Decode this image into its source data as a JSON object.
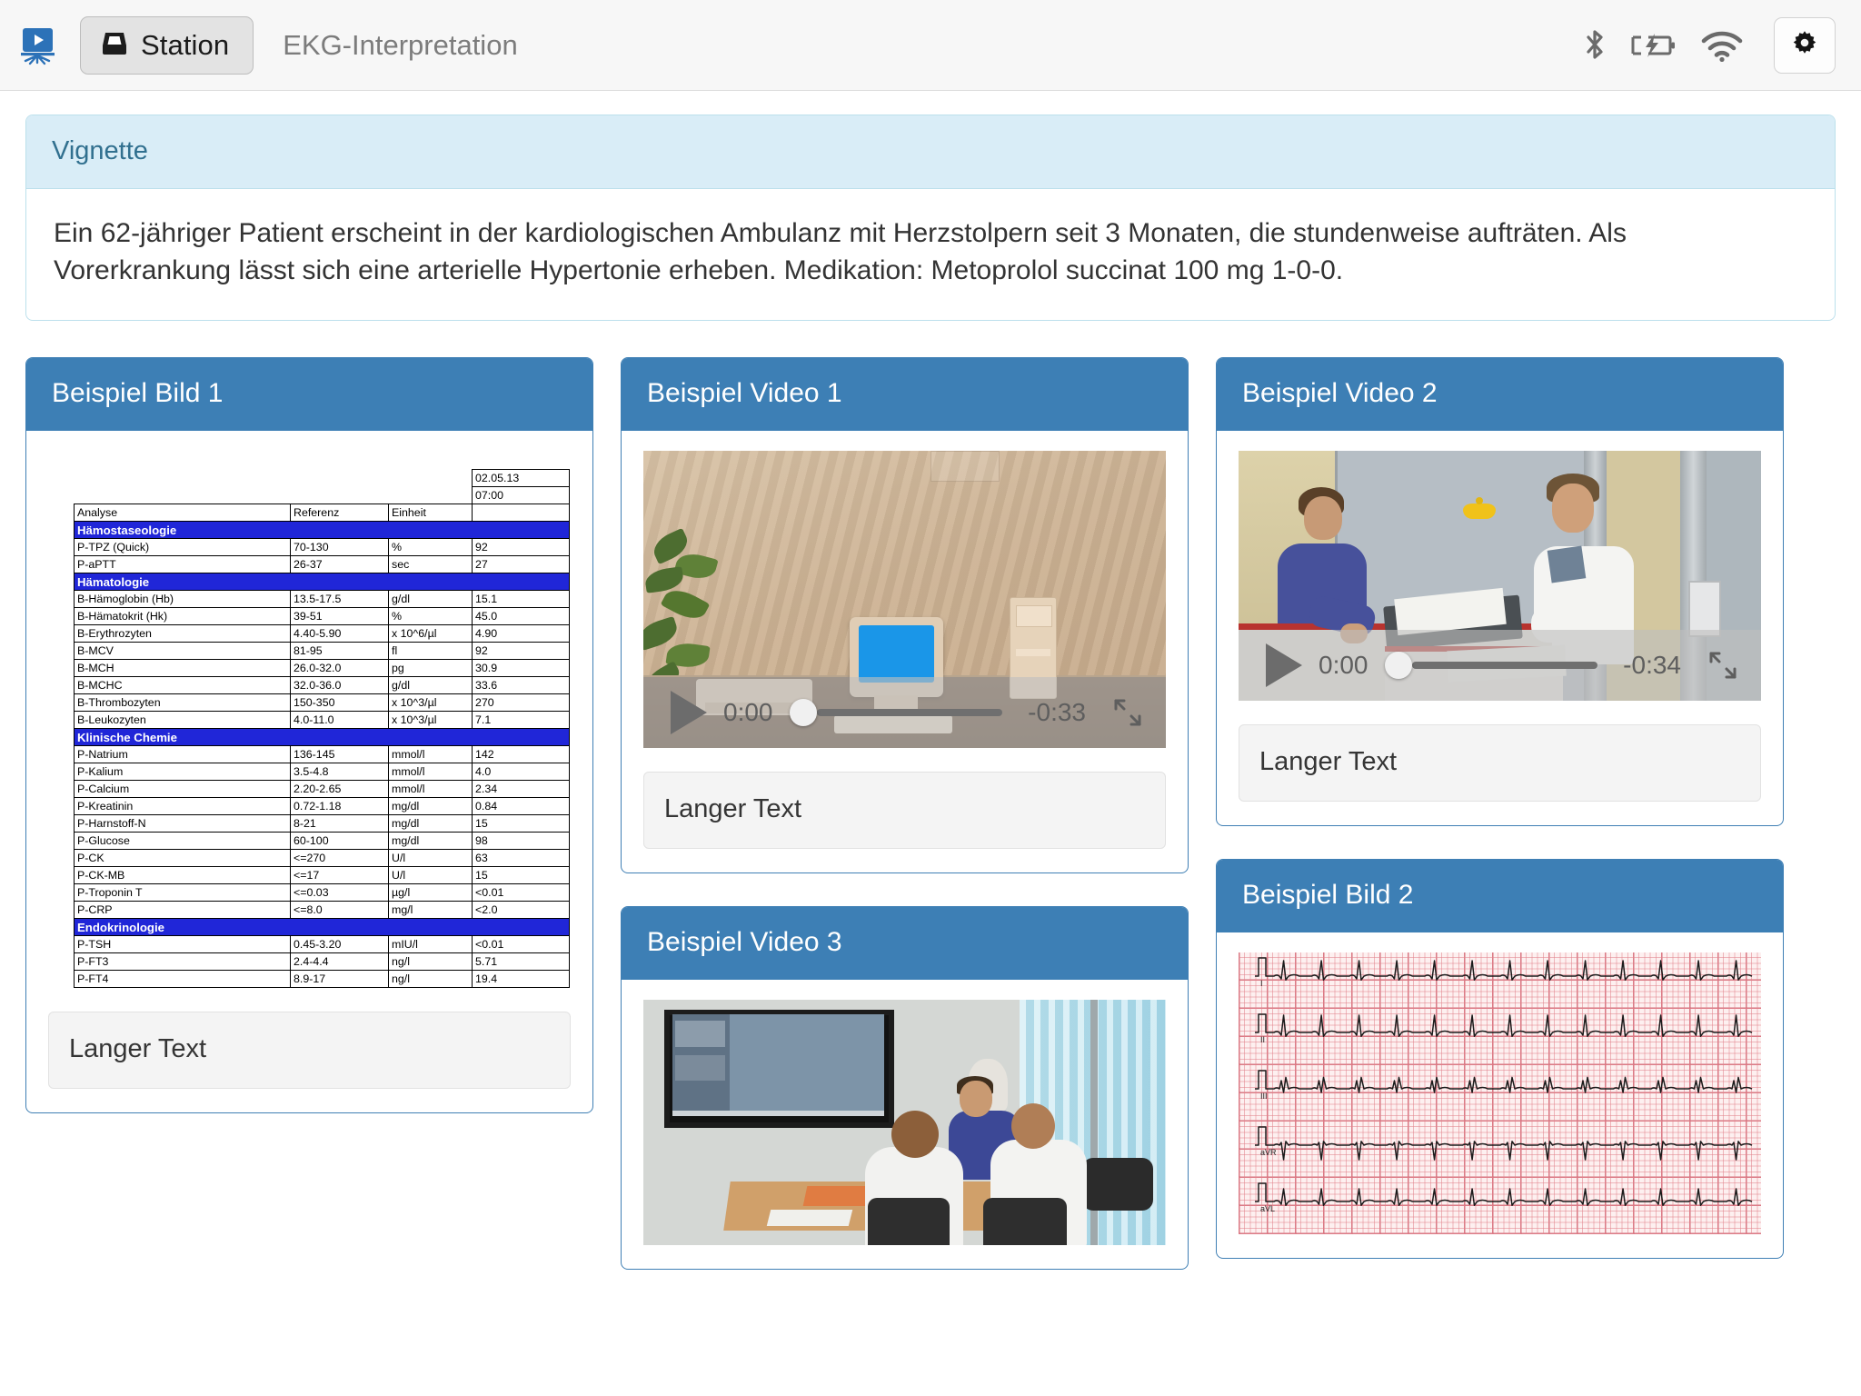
{
  "topbar": {
    "app_icon": "presentation-screen-icon",
    "station_button": {
      "label": "Station",
      "icon": "inbox-tray-icon"
    },
    "page_title": "EKG-Interpretation",
    "status_icons": [
      "bluetooth-icon",
      "battery-charging-icon",
      "wifi-icon"
    ],
    "settings_button": {
      "icon": "gear-icon"
    }
  },
  "vignette": {
    "heading": "Vignette",
    "body": "Ein 62-jähriger Patient erscheint in der kardiologischen Ambulanz mit Herzstolpern seit 3 Monaten, die stundenweise aufträten. Als Vorerkrankung lässt sich eine arterielle Hypertonie erheben. Medikation: Metoprolol succinat 100 mg 1-0-0."
  },
  "cards": {
    "bild1": {
      "title": "Beispiel Bild 1",
      "caption": "Langer Text"
    },
    "video1": {
      "title": "Beispiel Video 1",
      "caption": "Langer Text"
    },
    "video2": {
      "title": "Beispiel Video 2",
      "caption": "Langer Text"
    },
    "video3": {
      "title": "Beispiel Video 3"
    },
    "bild2": {
      "title": "Beispiel Bild 2"
    }
  },
  "players": {
    "video1": {
      "current_time": "0:00",
      "remaining_time": "-0:33",
      "progress_percent": 0,
      "play_icon": "play-icon",
      "fullscreen_icon": "fullscreen-icon"
    },
    "video2": {
      "current_time": "0:00",
      "remaining_time": "-0:34",
      "progress_percent": 0,
      "play_icon": "play-icon",
      "fullscreen_icon": "fullscreen-icon"
    }
  },
  "lab_report": {
    "date": "02.05.13",
    "time": "07:00",
    "headers": [
      "Analyse",
      "Referenz",
      "Einheit",
      ""
    ],
    "section_color": "#2026d8",
    "rows": [
      {
        "type": "section",
        "label": "Hämostaseologie"
      },
      {
        "type": "data",
        "analyse": "P-TPZ (Quick)",
        "referenz": "70-130",
        "einheit": "%",
        "wert": "92"
      },
      {
        "type": "data",
        "analyse": "P-aPTT",
        "referenz": "26-37",
        "einheit": "sec",
        "wert": "27"
      },
      {
        "type": "section",
        "label": "Hämatologie"
      },
      {
        "type": "data",
        "analyse": "B-Hämoglobin (Hb)",
        "referenz": "13.5-17.5",
        "einheit": "g/dl",
        "wert": "15.1"
      },
      {
        "type": "data",
        "analyse": "B-Hämatokrit (Hk)",
        "referenz": "39-51",
        "einheit": "%",
        "wert": "45.0"
      },
      {
        "type": "data",
        "analyse": "B-Erythrozyten",
        "referenz": "4.40-5.90",
        "einheit": "x 10^6/µl",
        "wert": "4.90"
      },
      {
        "type": "data",
        "analyse": "B-MCV",
        "referenz": "81-95",
        "einheit": "fl",
        "wert": "92"
      },
      {
        "type": "data",
        "analyse": "B-MCH",
        "referenz": "26.0-32.0",
        "einheit": "pg",
        "wert": "30.9"
      },
      {
        "type": "data",
        "analyse": "B-MCHC",
        "referenz": "32.0-36.0",
        "einheit": "g/dl",
        "wert": "33.6"
      },
      {
        "type": "data",
        "analyse": "B-Thrombozyten",
        "referenz": "150-350",
        "einheit": "x 10^3/µl",
        "wert": "270"
      },
      {
        "type": "data",
        "analyse": "B-Leukozyten",
        "referenz": "4.0-11.0",
        "einheit": "x 10^3/µl",
        "wert": "7.1"
      },
      {
        "type": "section",
        "label": "Klinische Chemie"
      },
      {
        "type": "data",
        "analyse": "P-Natrium",
        "referenz": "136-145",
        "einheit": "mmol/l",
        "wert": "142"
      },
      {
        "type": "data",
        "analyse": "P-Kalium",
        "referenz": "3.5-4.8",
        "einheit": "mmol/l",
        "wert": "4.0"
      },
      {
        "type": "data",
        "analyse": "P-Calcium",
        "referenz": "2.20-2.65",
        "einheit": "mmol/l",
        "wert": "2.34"
      },
      {
        "type": "data",
        "analyse": "P-Kreatinin",
        "referenz": "0.72-1.18",
        "einheit": "mg/dl",
        "wert": "0.84"
      },
      {
        "type": "data",
        "analyse": "P-Harnstoff-N",
        "referenz": "8-21",
        "einheit": "mg/dl",
        "wert": "15"
      },
      {
        "type": "data",
        "analyse": "P-Glucose",
        "referenz": "60-100",
        "einheit": "mg/dl",
        "wert": "98"
      },
      {
        "type": "data",
        "analyse": "P-CK",
        "referenz": "<=270",
        "einheit": "U/l",
        "wert": "63"
      },
      {
        "type": "data",
        "analyse": "P-CK-MB",
        "referenz": "<=17",
        "einheit": "U/l",
        "wert": "15"
      },
      {
        "type": "data",
        "analyse": "P-Troponin T",
        "referenz": "<=0.03",
        "einheit": "µg/l",
        "wert": "<0.01"
      },
      {
        "type": "data",
        "analyse": "P-CRP",
        "referenz": "<=8.0",
        "einheit": "mg/l",
        "wert": "<2.0"
      },
      {
        "type": "section",
        "label": "Endokrinologie"
      },
      {
        "type": "data",
        "analyse": "P-TSH",
        "referenz": "0.45-3.20",
        "einheit": "mIU/l",
        "wert": "<0.01"
      },
      {
        "type": "data",
        "analyse": "P-FT3",
        "referenz": "2.4-4.4",
        "einheit": "ng/l",
        "wert": "5.71"
      },
      {
        "type": "data",
        "analyse": "P-FT4",
        "referenz": "8.9-17",
        "einheit": "ng/l",
        "wert": "19.4"
      }
    ]
  },
  "ekg": {
    "leads": [
      "I",
      "II",
      "III",
      "aVR",
      "aVL"
    ],
    "paper_color": "#fdf0f0",
    "grid_color": "#cd5a69"
  },
  "colors": {
    "card_header": "#3d7fb5",
    "panel_info_header": "#d9edf7",
    "panel_info_border": "#bce0ec",
    "panel_info_text": "#31708f"
  }
}
